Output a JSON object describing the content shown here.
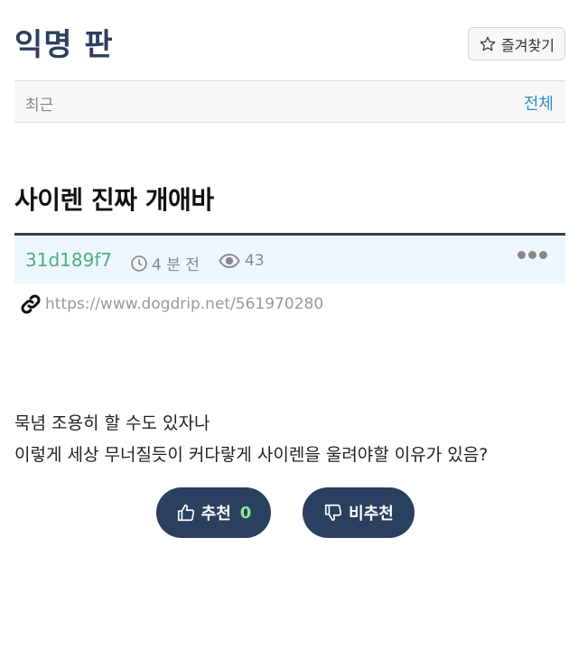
{
  "board": {
    "title": "익명 판",
    "favorite_label": "즐겨찾기"
  },
  "filter": {
    "recent_label": "최근",
    "all_label": "전체"
  },
  "post": {
    "title": "사이렌 진짜 개애바",
    "author": "31d189f7",
    "time": "4 분 전",
    "views": "43",
    "link": "https://www.dogdrip.net/561970280",
    "content": [
      "묵념 조용히 할 수도 있자나",
      "이렇게 세상 무너질듯이 커다랗게 사이렌을 울려야할 이유가 있음?"
    ]
  },
  "votes": {
    "up_label": "추천",
    "up_count": "0",
    "down_label": "비추천"
  },
  "icons": {
    "favorite": "star-outline-icon",
    "time": "clock-icon",
    "views": "eye-icon",
    "more": "more-dots-icon",
    "link": "link-icon",
    "up": "thumbs-up-icon",
    "down": "thumbs-down-icon"
  },
  "colors": {
    "title": "#2d3f5c",
    "accent_link": "#3a8bc4",
    "author": "#4caf7f",
    "meta_bg": "#eef6fd",
    "button_bg": "#2b3f5e",
    "vote_count": "#8ee58e"
  }
}
